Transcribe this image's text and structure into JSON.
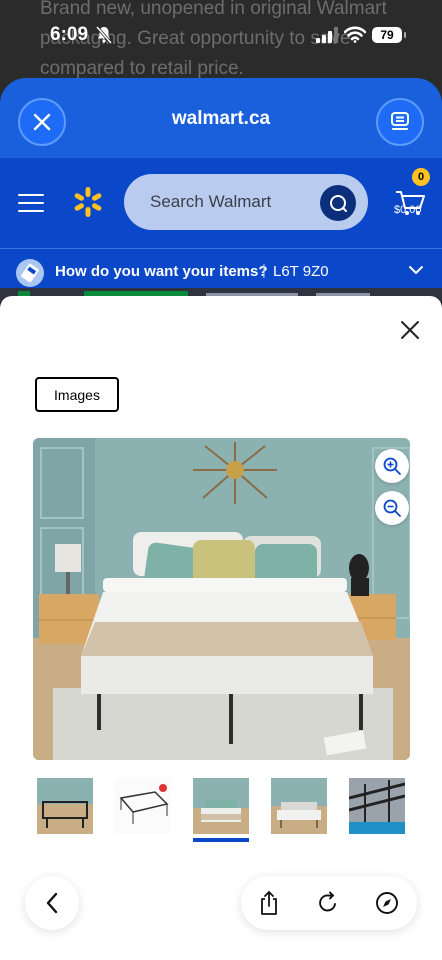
{
  "background": {
    "listing_text": "Brand new, unopened in original Walmart packaging. Great opportunity to save compared to retail price."
  },
  "status_bar": {
    "time": "6:09",
    "battery": "79"
  },
  "browser": {
    "domain": "walmart.ca"
  },
  "walmart": {
    "search_placeholder": "Search Walmart",
    "cart_count": "0",
    "cart_total": "$0.00",
    "delivery_prompt": "How do you want your items?",
    "delivery_separator": "|",
    "postal_code": "L6T 9Z0"
  },
  "modal": {
    "tab_label": "Images",
    "thumbnail_count": 5,
    "active_thumbnail": 3
  },
  "colors": {
    "browser_blue": "#1a5fdc",
    "walmart_blue": "#0a47c9",
    "spark_yellow": "#ffc220"
  }
}
